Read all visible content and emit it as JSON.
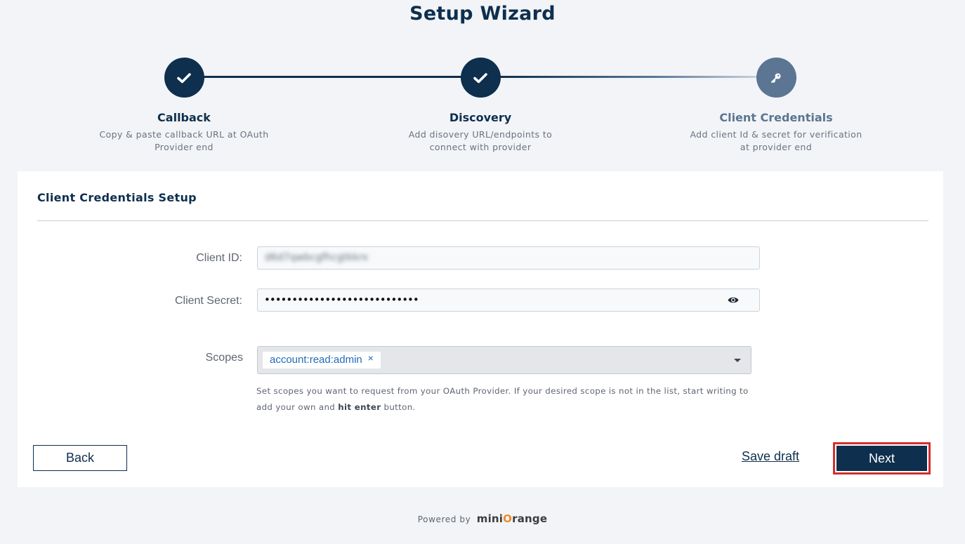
{
  "title": "Setup Wizard",
  "steps": [
    {
      "name": "Callback",
      "description": "Copy & paste callback URL at OAuth Provider end",
      "status": "complete",
      "icon": "check-icon"
    },
    {
      "name": "Discovery",
      "description": "Add disovery URL/endpoints to connect with provider",
      "status": "complete",
      "icon": "check-icon"
    },
    {
      "name": "Client Credentials",
      "description": "Add client Id & secret for verification at provider end",
      "status": "active",
      "icon": "key-icon"
    }
  ],
  "card": {
    "title": "Client Credentials Setup",
    "client_id": {
      "label": "Client ID:",
      "value": "d6d7qwbcgfhcgtkkrx"
    },
    "client_secret": {
      "label": "Client Secret:",
      "value": "••••••••••••••••••••••••••••"
    },
    "scopes": {
      "label": "Scopes",
      "selected": [
        "account:read:admin"
      ],
      "remove_symbol": "×",
      "help_text_before": "Set scopes you want to request from your OAuth Provider. If your desired scope is not in the list, start writing to add your own and ",
      "help_text_bold": "hit enter",
      "help_text_after": " button."
    }
  },
  "actions": {
    "back": "Back",
    "save_draft": "Save draft",
    "next": "Next"
  },
  "footer": {
    "powered_by": "Powered by",
    "brand_prefix": "mini",
    "brand_o": "O",
    "brand_suffix": "range"
  },
  "colors": {
    "primary": "#0e2f4e",
    "inactive_step": "#5b7592",
    "highlight_border": "#d32f2f",
    "brand_orange": "#f08a24"
  }
}
